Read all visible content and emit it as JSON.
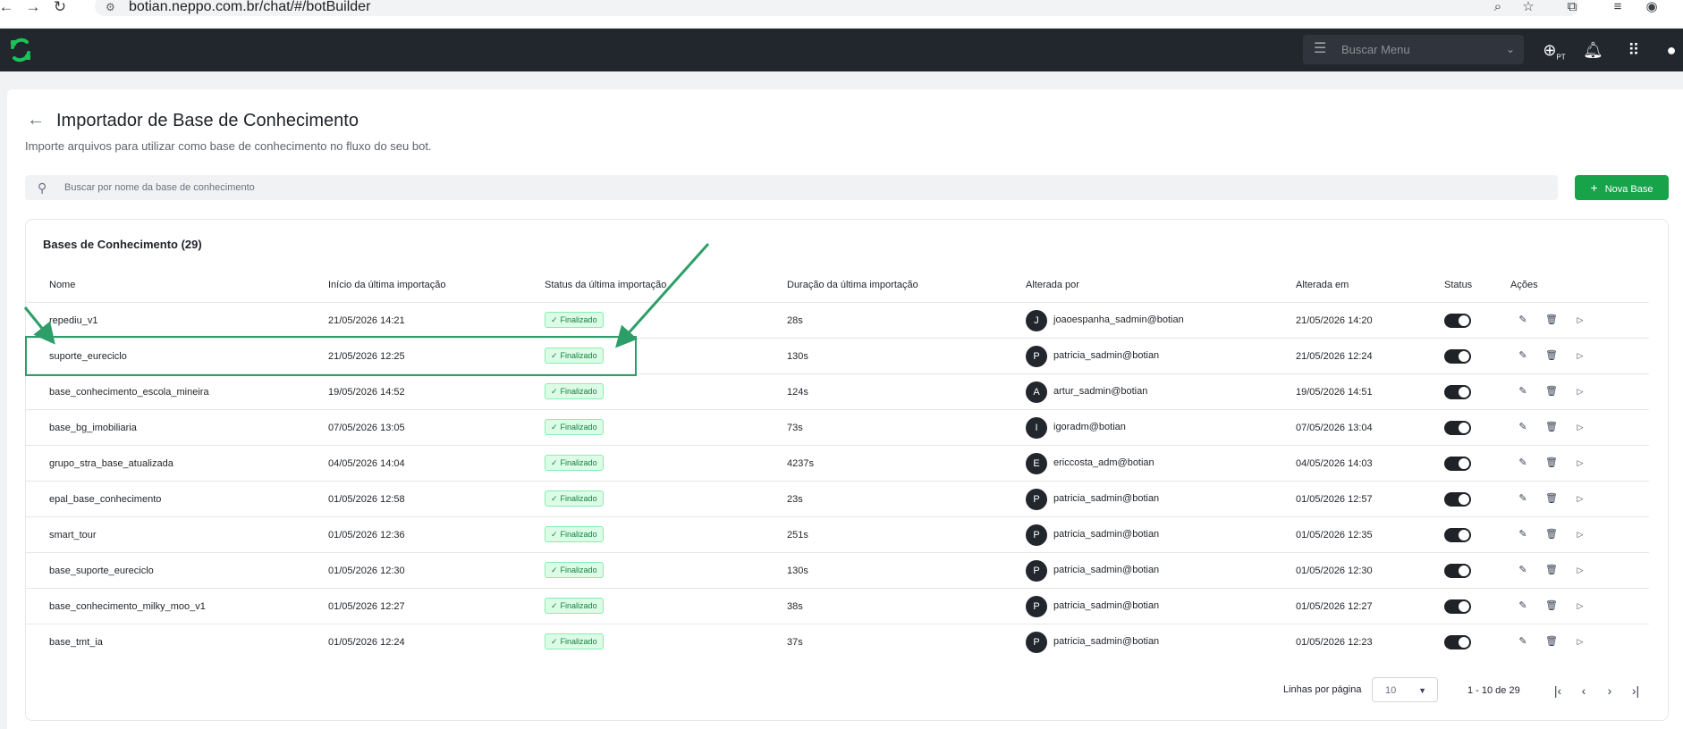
{
  "browser": {
    "url": "botian.neppo.com.br/chat/#/botBuilder"
  },
  "header": {
    "menu_search_placeholder": "Buscar Menu",
    "lang_code": "PT"
  },
  "page": {
    "title": "Importador de Base de Conhecimento",
    "subtitle": "Importe arquivos para utilizar como base de conhecimento no fluxo do seu bot.",
    "search_placeholder": "Buscar por nome da base de conhecimento",
    "new_button_label": "Nova Base"
  },
  "table": {
    "title": "Bases de Conhecimento (29)",
    "columns": {
      "name": "Nome",
      "import_start": "Início da última importação",
      "import_status": "Status da última importação",
      "import_duration": "Duração da última importação",
      "changed_by": "Alterada por",
      "changed_at": "Alterada em",
      "status": "Status",
      "actions": "Ações"
    },
    "rows": [
      {
        "name": "repediu_v1",
        "start": "21/05/2026 14:21",
        "status": "Finalizado",
        "duration": "28s",
        "initial": "J",
        "user": "joaoespanha_sadmin@botian",
        "changed": "21/05/2026 14:20"
      },
      {
        "name": "suporte_eureciclo",
        "start": "21/05/2026 12:25",
        "status": "Finalizado",
        "duration": "130s",
        "initial": "P",
        "user": "patricia_sadmin@botian",
        "changed": "21/05/2026 12:24"
      },
      {
        "name": "base_conhecimento_escola_mineira",
        "start": "19/05/2026 14:52",
        "status": "Finalizado",
        "duration": "124s",
        "initial": "A",
        "user": "artur_sadmin@botian",
        "changed": "19/05/2026 14:51"
      },
      {
        "name": "base_bg_imobiliaria",
        "start": "07/05/2026 13:05",
        "status": "Finalizado",
        "duration": "73s",
        "initial": "I",
        "user": "igoradm@botian",
        "changed": "07/05/2026 13:04"
      },
      {
        "name": "grupo_stra_base_atualizada",
        "start": "04/05/2026 14:04",
        "status": "Finalizado",
        "duration": "4237s",
        "initial": "E",
        "user": "ericcosta_adm@botian",
        "changed": "04/05/2026 14:03"
      },
      {
        "name": "epal_base_conhecimento",
        "start": "01/05/2026 12:58",
        "status": "Finalizado",
        "duration": "23s",
        "initial": "P",
        "user": "patricia_sadmin@botian",
        "changed": "01/05/2026 12:57"
      },
      {
        "name": "smart_tour",
        "start": "01/05/2026 12:36",
        "status": "Finalizado",
        "duration": "251s",
        "initial": "P",
        "user": "patricia_sadmin@botian",
        "changed": "01/05/2026 12:35"
      },
      {
        "name": "base_suporte_eureciclo",
        "start": "01/05/2026 12:30",
        "status": "Finalizado",
        "duration": "130s",
        "initial": "P",
        "user": "patricia_sadmin@botian",
        "changed": "01/05/2026 12:30"
      },
      {
        "name": "base_conhecimento_milky_moo_v1",
        "start": "01/05/2026 12:27",
        "status": "Finalizado",
        "duration": "38s",
        "initial": "P",
        "user": "patricia_sadmin@botian",
        "changed": "01/05/2026 12:27"
      },
      {
        "name": "base_tmt_ia",
        "start": "01/05/2026 12:24",
        "status": "Finalizado",
        "duration": "37s",
        "initial": "P",
        "user": "patricia_sadmin@botian",
        "changed": "01/05/2026 12:23"
      }
    ]
  },
  "pagination": {
    "rows_per_page_label": "Linhas por página",
    "rows_per_page_value": "10",
    "range": "1 - 10 de 29"
  },
  "colors": {
    "accent": "#16a34a",
    "header_bg": "#22262d",
    "annotation": "#2e9e68"
  }
}
